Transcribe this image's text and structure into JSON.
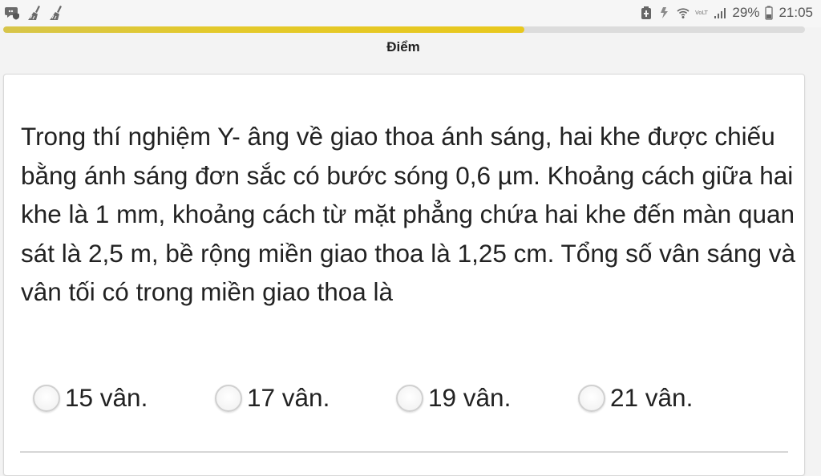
{
  "statusbar": {
    "left_icons": [
      "message-shield-icon",
      "cleaning-broom-icon",
      "cleaning-broom-icon"
    ],
    "right_icons": [
      "battery-saver-icon",
      "data-transfer-icon",
      "wifi-icon",
      "volte-icon",
      "signal-icon"
    ],
    "battery_percent": "29%",
    "time": "21:05"
  },
  "progress": {
    "value_fraction": 0.65
  },
  "header": {
    "score_label": "Điểm"
  },
  "question": {
    "text": "Trong thí nghiệm Y- âng về giao thoa ánh sáng, hai khe được chiếu bằng ánh sáng đơn sắc có bước sóng 0,6 µm. Khoảng cách giữa hai khe là 1 mm, khoảng cách từ mặt phẳng chứa hai khe đến màn quan sát là 2,5 m, bề rộng miền giao thoa là 1,25 cm. Tổng số vân sáng và vân tối có trong miền giao thoa là"
  },
  "options": [
    {
      "label": "15 vân."
    },
    {
      "label": "17 vân."
    },
    {
      "label": "19 vân."
    },
    {
      "label": "21 vân."
    }
  ],
  "colors": {
    "accent": "#e3c92b",
    "track": "#dcdcdc",
    "card": "#ffffff"
  }
}
